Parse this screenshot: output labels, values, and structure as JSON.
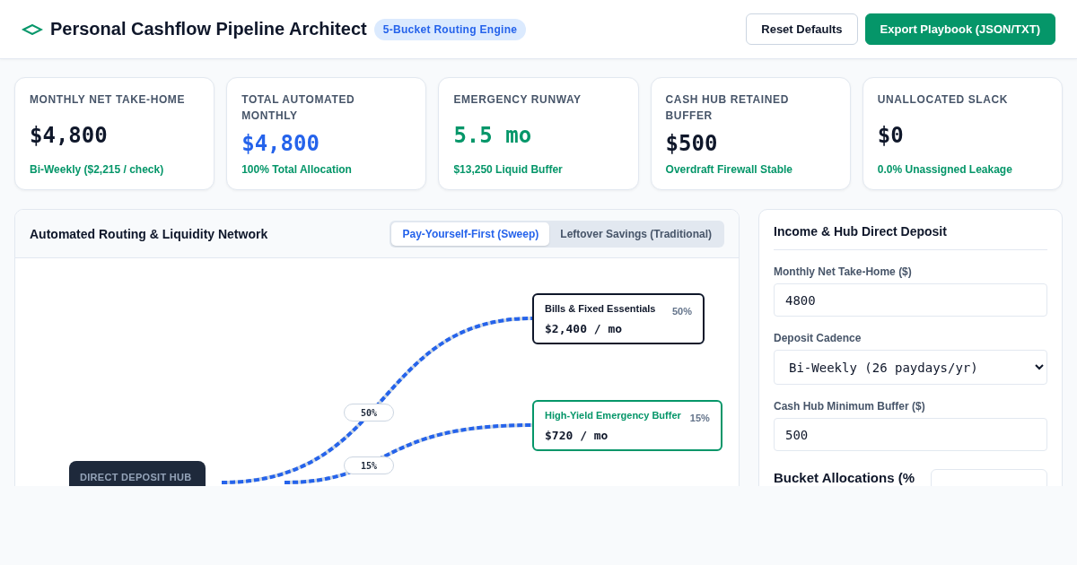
{
  "header": {
    "title": "Personal Cashflow Pipeline Architect",
    "badge": "5-Bucket Routing Engine",
    "buttons": [
      {
        "label": "Reset Defaults",
        "kind": "secondary"
      },
      {
        "label": "Export Playbook (JSON/TXT)",
        "kind": "primary"
      }
    ]
  },
  "stats": [
    {
      "label": "MONTHLY NET TAKE-HOME",
      "value": "$4,800",
      "color": "#0f172a",
      "note": "Bi-Weekly ($2,215 / check)"
    },
    {
      "label": "TOTAL AUTOMATED MONTHLY",
      "value": "$4,800",
      "color": "#2563eb",
      "note": "100% Total Allocation"
    },
    {
      "label": "EMERGENCY RUNWAY",
      "value": "5.5 mo",
      "color": "#059669",
      "note": "$13,250 Liquid Buffer"
    },
    {
      "label": "CASH HUB RETAINED BUFFER",
      "value": "$500",
      "color": "#0f172a",
      "note": "Overdraft Firewall Stable"
    },
    {
      "label": "UNALLOCATED SLACK",
      "value": "$0",
      "color": "#0f172a",
      "note": "0.0% Unassigned Leakage"
    }
  ],
  "network": {
    "title": "Automated Routing & Liquidity Network",
    "tabs": [
      {
        "label": "Pay-Yourself-First (Sweep)",
        "selected": true
      },
      {
        "label": "Leftover Savings (Traditional)",
        "selected": false
      }
    ],
    "hub": {
      "label": "DIRECT DEPOSIT HUB"
    },
    "buckets": [
      {
        "name": "Bills & Fixed Essentials",
        "amount": "$2,400 / mo",
        "share": "50%",
        "flow_label": "50%",
        "kind": "essential"
      },
      {
        "name": "High-Yield Emergency Buffer",
        "amount": "$720 / mo",
        "share": "15%",
        "flow_label": "15%",
        "kind": "savings"
      }
    ]
  },
  "settings": {
    "title": "Income & Hub Direct Deposit",
    "fields": [
      {
        "label": "Monthly Net Take-Home ($)",
        "value": "4800",
        "kind": "input"
      },
      {
        "label": "Deposit Cadence",
        "value": "Bi-Weekly (26 paydays/yr)",
        "kind": "select"
      },
      {
        "label": "Cash Hub Minimum Buffer ($)",
        "value": "500",
        "kind": "input"
      }
    ],
    "section_title": "Bucket Allocations (%"
  }
}
